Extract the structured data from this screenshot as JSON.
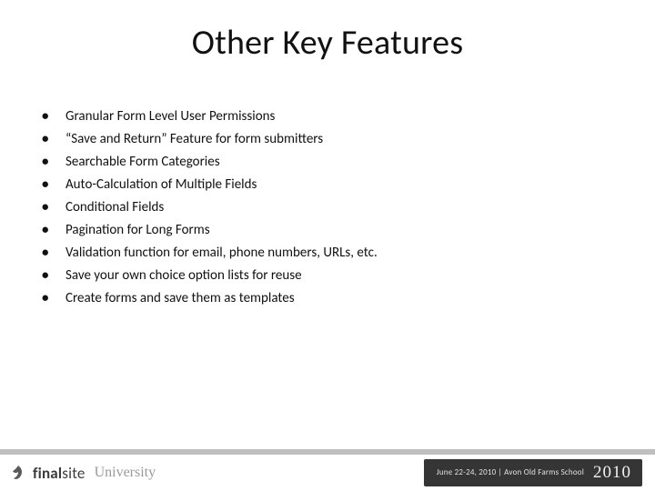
{
  "title": "Other Key Features",
  "bullets": [
    "Granular Form Level User Permissions",
    "“Save and Return” Feature for form submitters",
    "Searchable Form Categories",
    "Auto-Calculation of Multiple Fields",
    "Conditional Fields",
    "Pagination for Long Forms",
    "Validation function for email, phone numbers, URLs, etc.",
    "Save your own choice option lists for reuse",
    "Create forms and save them as templates"
  ],
  "footer": {
    "brand_bold": "final",
    "brand_rest": "site",
    "university": "University",
    "meta": "June 22-24, 2010 | Avon Old Farms School",
    "year": "2010"
  }
}
